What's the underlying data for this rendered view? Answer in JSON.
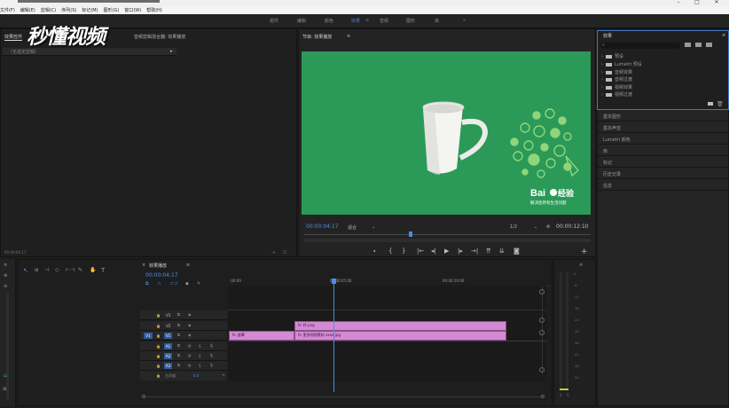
{
  "menubar": {
    "items": [
      "文件(F)",
      "编辑(E)",
      "剪辑(C)",
      "序列(S)",
      "标记(M)",
      "图形(G)",
      "窗口(W)",
      "帮助(H)"
    ]
  },
  "workspace": {
    "tabs": [
      "组件",
      "编辑",
      "颜色",
      "效果",
      "音频",
      "图形",
      "库"
    ],
    "active_index": 3,
    "overflow": "»"
  },
  "watermark": {
    "text": "秒懂视频"
  },
  "left_panel": {
    "tab_label": "效果控件",
    "tab_label2": "音频剪辑混合器: 效果播放",
    "source_label": "（无选定剪辑）",
    "timecode": "00:00:04:17"
  },
  "program": {
    "tab_label": "节目: 效果播放",
    "current_time": "00:00:04:17",
    "fit_label": "适合",
    "resolution": "1/2",
    "duration": "00:00:12:10",
    "playhead_fraction": 0.37
  },
  "video": {
    "brand_logo": "Bai",
    "brand_suffix": "经验",
    "tagline": "解决您所有生活问题",
    "colors": {
      "background": "#2b9a58"
    }
  },
  "effects": {
    "panel_title": "效果",
    "tree": [
      "预设",
      "Lumetri 预设",
      "音频效果",
      "音频过渡",
      "视频效果",
      "视频过渡"
    ],
    "rows": [
      "基本图形",
      "基本声音",
      "Lumetri 颜色",
      "库",
      "标记",
      "历史记录",
      "信息"
    ]
  },
  "timeline": {
    "tab_label": "效果播放",
    "timecode": "00:00:04:17",
    "ruler": [
      ":00:00",
      "00:00:05:00",
      "00:00:10:00"
    ],
    "tracks_video": [
      "V3",
      "V2",
      "V1"
    ],
    "tracks_audio": [
      "A1",
      "A2",
      "A3"
    ],
    "master_label": "主声道",
    "master_value": "0.0",
    "clips": {
      "v2": "杯.png",
      "v1_left": "遮罩",
      "v1_right": "更多视频素材 xxxx.jpg"
    },
    "colors": {
      "clip": "#d38ad3",
      "work_area": "#c8c832"
    }
  },
  "meters": {
    "scale": [
      "0",
      "-6",
      "-12",
      "-18",
      "-24",
      "-30",
      "-36",
      "-42",
      "-48",
      "-54"
    ],
    "footer": [
      "S",
      "S"
    ]
  },
  "colors": {
    "accent": "#4a7ec7"
  }
}
